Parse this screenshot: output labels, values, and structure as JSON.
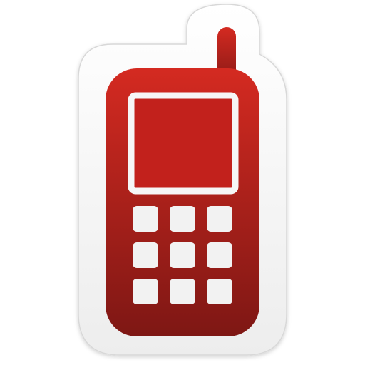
{
  "icon": {
    "name": "mobile-phone-icon",
    "colors": {
      "sticker_background": "#f4f4f4",
      "sticker_edge": "#d8d8d8",
      "body_top": "#d42a21",
      "body_bottom": "#7e1714",
      "screen": "#c2211c",
      "screen_frame": "#f6f6f6",
      "keys": "#f2f2f2"
    },
    "keypad": {
      "rows": 3,
      "columns": 3
    }
  }
}
